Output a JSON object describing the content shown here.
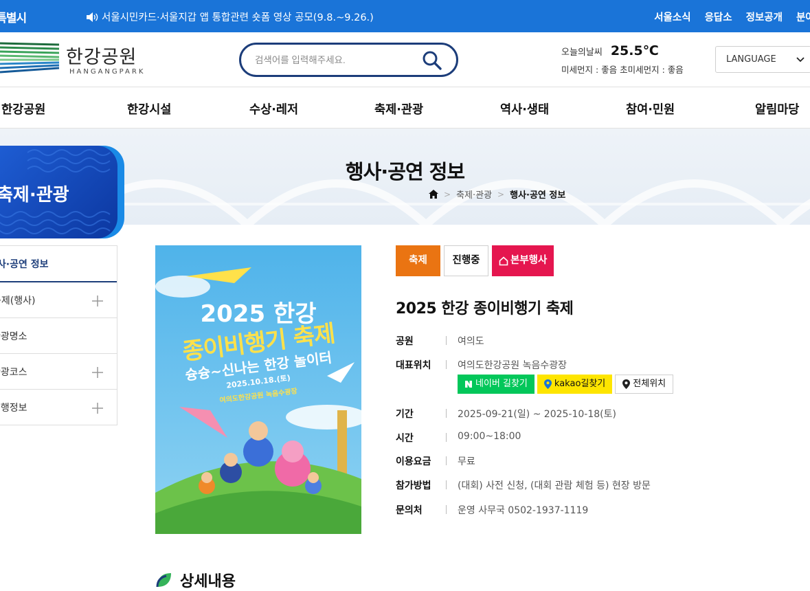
{
  "topbar": {
    "brand": "서울특별시",
    "notice": "서울시민카드·서울지갑 앱 통합관련 숏폼 영상 공모(9.8.~9.26.)",
    "links": [
      "서울소식",
      "응답소",
      "정보공개",
      "분야별"
    ]
  },
  "header": {
    "logo_ko": "한강공원",
    "logo_en": "HANGANGPARK",
    "search_placeholder": "검색어를 입력해주세요.",
    "weather_label": "오늘의날씨",
    "temperature": "25.5℃",
    "dust": "미세먼지 : 좋음   초미세먼지 : 좋음",
    "language": "LANGUAGE"
  },
  "gnb": [
    "한강공원",
    "한강시설",
    "수상·레저",
    "축제·관광",
    "역사·생태",
    "참여·민원",
    "알림마당"
  ],
  "visual": {
    "title": "행사·공연 정보",
    "breadcrumb": [
      "축제·관광",
      "행사·공연 정보"
    ]
  },
  "lnb": {
    "title": "축제·관광",
    "items": [
      "행사·공연 정보",
      "축제(행사)",
      "관광명소",
      "관광코스",
      "여행정보"
    ],
    "expandable": [
      false,
      true,
      false,
      true,
      true
    ]
  },
  "poster": {
    "line1": "2025 한강",
    "line2": "종이비행기 축제",
    "line3": "슝슝~신나는 한강 놀이터",
    "date": "2025.10.18.(토)",
    "place": "여의도한강공원 녹음수광장"
  },
  "event": {
    "badges": [
      "축제",
      "진행중",
      "본부행사"
    ],
    "title": "2025 한강 종이비행기 축제",
    "fields": [
      {
        "key": "공원",
        "value": "여의도"
      },
      {
        "key": "대표위치",
        "value": "여의도한강공원 녹음수광장"
      },
      {
        "key": "기간",
        "value": "2025-09-21(일) ~ 2025-10-18(토)"
      },
      {
        "key": "시간",
        "value": "09:00~18:00"
      },
      {
        "key": "이용요금",
        "value": "무료"
      },
      {
        "key": "참가방법",
        "value": "(대회) 사전 신청, (대회 관람 체험 등) 현장 방문"
      },
      {
        "key": "문의처",
        "value": "운영 사무국 0502-1937-1119"
      }
    ],
    "map_buttons": [
      "네이버 길찾기",
      "kakao길찾기",
      "전체위치"
    ]
  },
  "detail_heading": "상세내용",
  "colors": {
    "topbar": "#1a74d8",
    "navy": "#1c3d7a",
    "festival_badge": "#ea7412",
    "main_badge": "#e5164f",
    "naver": "#03c75a",
    "kakao": "#fee500"
  }
}
